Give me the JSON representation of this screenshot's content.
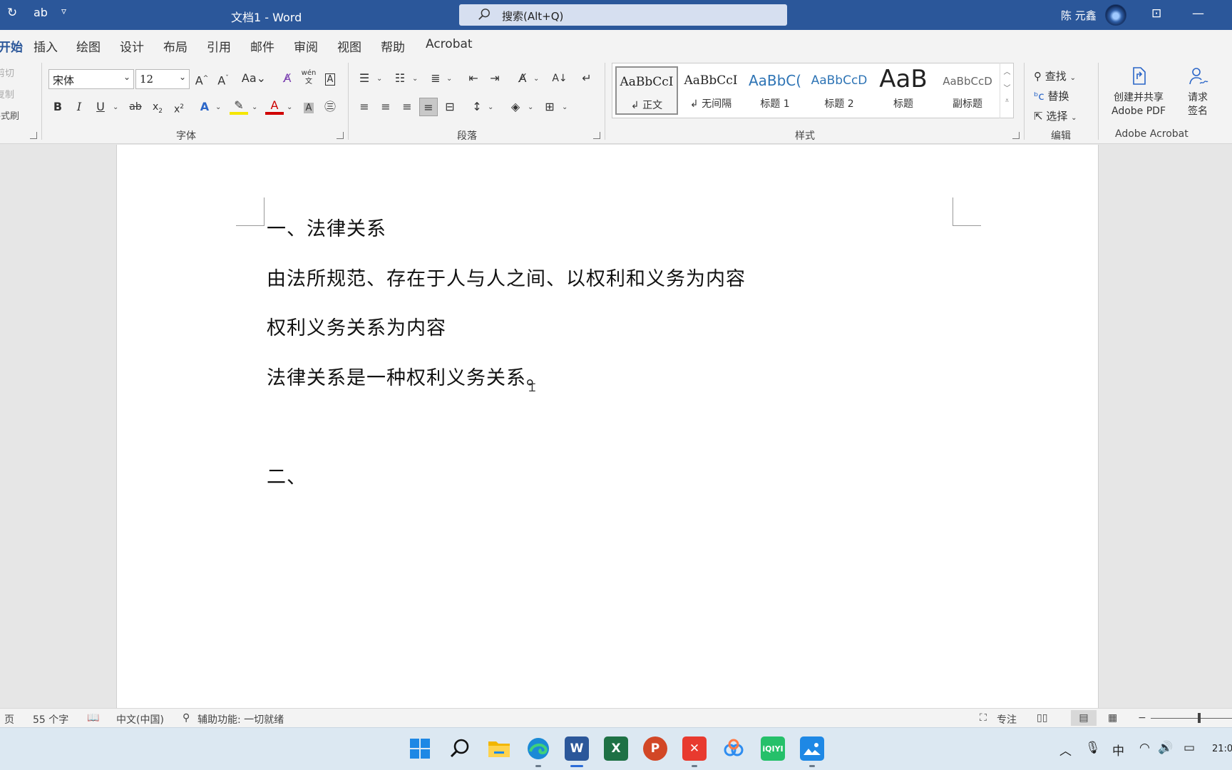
{
  "titlebar": {
    "doc_title": "文档1  -  Word",
    "search_placeholder": "搜索(Alt+Q)",
    "user_name": "陈 元鑫",
    "quick_access": [
      "↻",
      "ab",
      "▿"
    ]
  },
  "ribbon_tabs": [
    "开始",
    "插入",
    "绘图",
    "设计",
    "布局",
    "引用",
    "邮件",
    "审阅",
    "视图",
    "帮助",
    "Acrobat"
  ],
  "clipboard": {
    "items": [
      "剪切",
      "复制",
      "格式刷"
    ]
  },
  "font": {
    "name": "宋体",
    "size": "12",
    "group_label": "字体"
  },
  "paragraph": {
    "group_label": "段落"
  },
  "styles": {
    "group_label": "样式",
    "items": [
      {
        "sample": "AaBbCcI",
        "name": "↲ 正文"
      },
      {
        "sample": "AaBbCcI",
        "name": "↲ 无间隔"
      },
      {
        "sample": "AaBbC(",
        "name": "标题 1"
      },
      {
        "sample": "AaBbCcD",
        "name": "标题 2"
      },
      {
        "sample": "AaB",
        "name": "标题"
      },
      {
        "sample": "AaBbCcD",
        "name": "副标题"
      }
    ]
  },
  "editing": {
    "group_label": "编辑",
    "find": "查找",
    "replace": "替换",
    "select": "选择"
  },
  "acrobat": {
    "group_label": "Adobe Acrobat",
    "create_pdf_line1": "创建并共享",
    "create_pdf_line2": "Adobe PDF",
    "sign_line1": "请求",
    "sign_line2": "签名"
  },
  "document": {
    "paragraphs": [
      "一、法律关系",
      "由法所规范、存在于人与人之间、以权利和义务为内容",
      "权利义务关系为内容",
      "法律关系是一种权利义务关系。",
      "二、"
    ]
  },
  "status": {
    "page": "页",
    "word_count": "55 个字",
    "language": "中文(中国)",
    "accessibility": "辅助功能: 一切就绪",
    "focus": "专注"
  },
  "taskbar": {
    "apps": [
      "windows-start",
      "search",
      "file-explorer",
      "edge",
      "word",
      "excel",
      "powerpoint",
      "wps",
      "baidu-netdisk",
      "iqiyi",
      "photos"
    ],
    "ime": "中",
    "clock": "21:0"
  },
  "colors": {
    "word_blue": "#2b579a",
    "ribbon_bg": "#f3f3f3",
    "taskbar_bg": "#dce8f2"
  }
}
